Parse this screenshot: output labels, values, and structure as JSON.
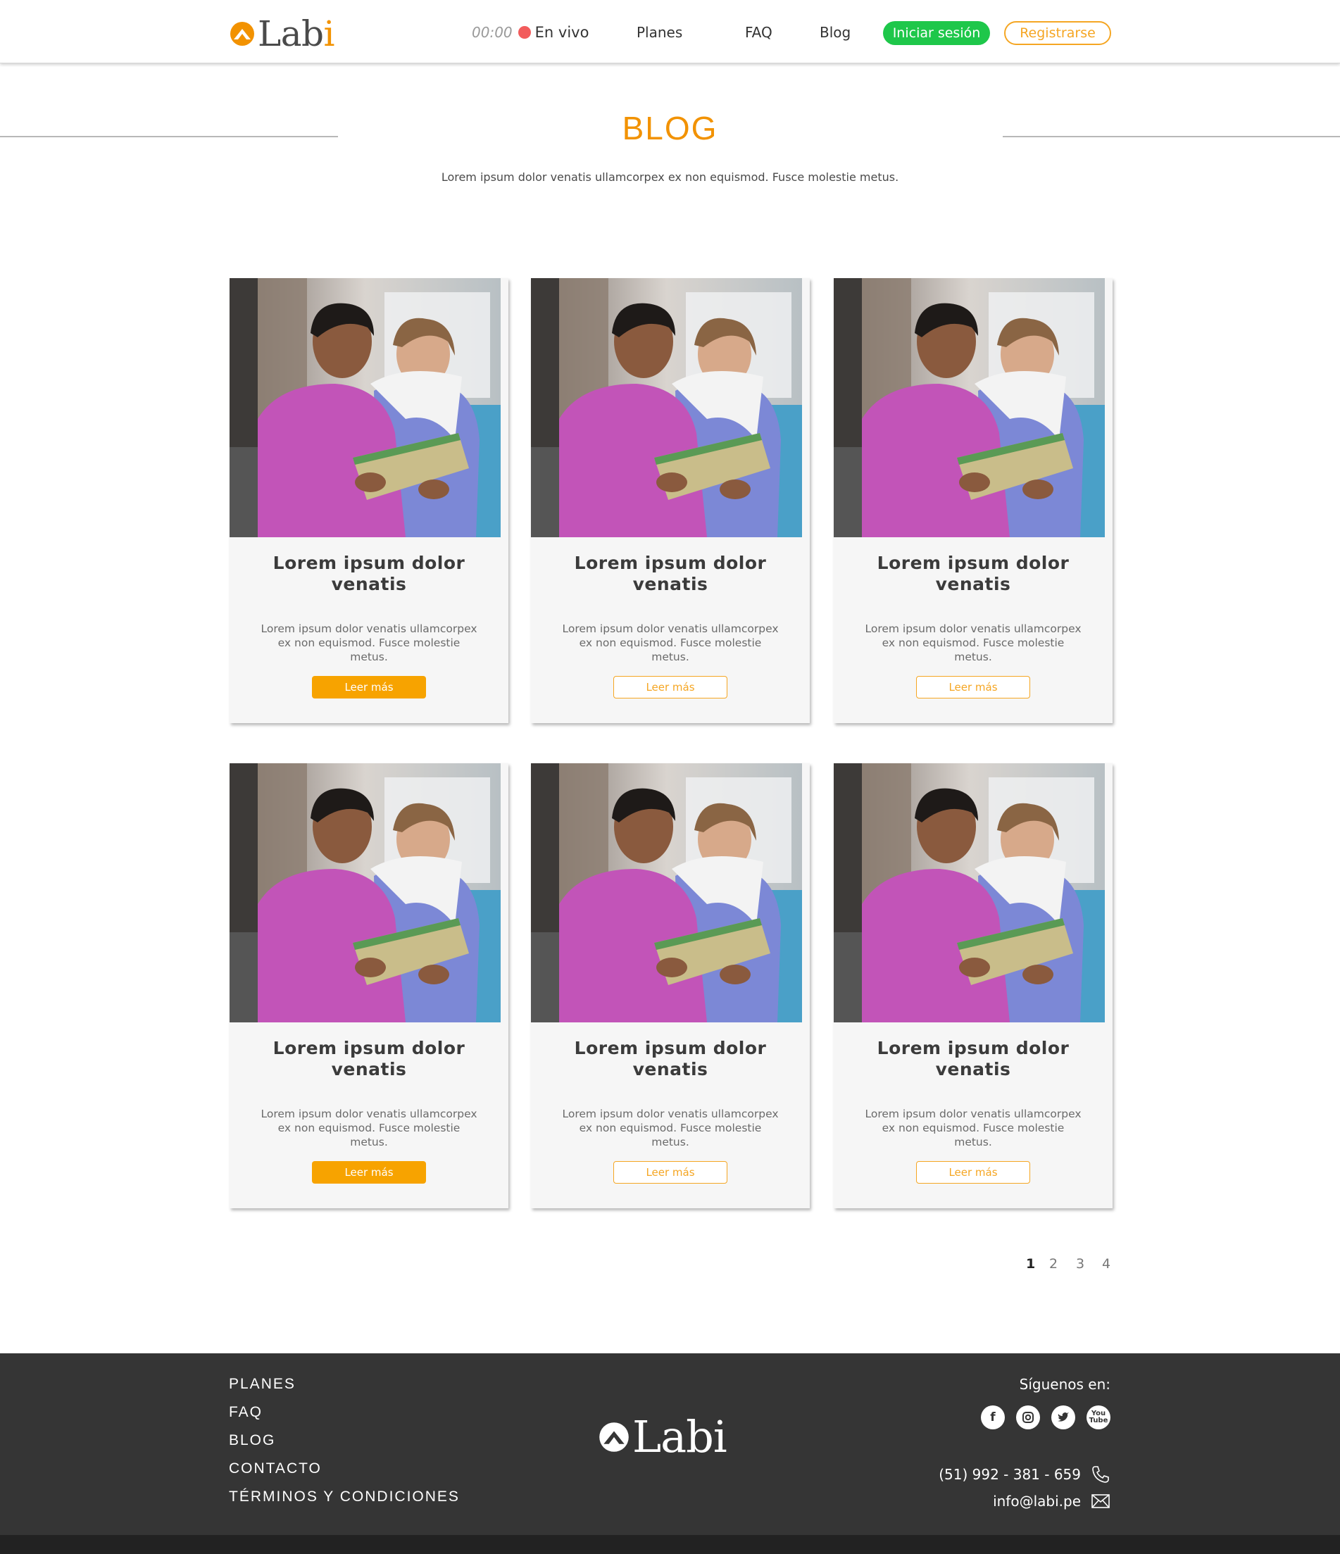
{
  "header": {
    "logo_text": "Lab",
    "logo_i": "i",
    "live_time": "00:00",
    "live_label": "En vivo",
    "nav": [
      "Planes",
      "FAQ",
      "Blog"
    ],
    "login_label": "Iniciar sesión",
    "register_label": "Registrarse"
  },
  "hero": {
    "title": "BLOG",
    "subtitle": "Lorem ipsum dolor venatis ullamcorpex ex non equismod. Fusce molestie metus."
  },
  "cards": [
    {
      "title": "Lorem ipsum dolor venatis",
      "text": "Lorem ipsum dolor venatis ullamcorpex ex non equismod. Fusce molestie metus.",
      "button": "Leer más",
      "style": "filled"
    },
    {
      "title": "Lorem ipsum dolor venatis",
      "text": "Lorem ipsum dolor venatis ullamcorpex ex non equismod. Fusce molestie metus.",
      "button": "Leer más",
      "style": "outline"
    },
    {
      "title": "Lorem ipsum dolor venatis",
      "text": "Lorem ipsum dolor venatis ullamcorpex ex non equismod. Fusce molestie metus.",
      "button": "Leer más",
      "style": "outline"
    },
    {
      "title": "Lorem ipsum dolor venatis",
      "text": "Lorem ipsum dolor venatis ullamcorpex ex non equismod. Fusce molestie metus.",
      "button": "Leer más",
      "style": "filled"
    },
    {
      "title": "Lorem ipsum dolor venatis",
      "text": "Lorem ipsum dolor venatis ullamcorpex ex non equismod. Fusce molestie metus.",
      "button": "Leer más",
      "style": "outline"
    },
    {
      "title": "Lorem ipsum dolor venatis",
      "text": "Lorem ipsum dolor venatis ullamcorpex ex non equismod. Fusce molestie metus.",
      "button": "Leer más",
      "style": "outline"
    }
  ],
  "pagination": {
    "pages": [
      "1",
      "2",
      "3",
      "4"
    ],
    "current": "1"
  },
  "footer": {
    "links": [
      "PLANES",
      "FAQ",
      "BLOG",
      "CONTACTO",
      "TÉRMINOS Y CONDICIONES"
    ],
    "logo_text": "Labi",
    "follow_label": "Síguenos en:",
    "socials": [
      "facebook-icon",
      "instagram-icon",
      "twitter-icon",
      "youtube-icon"
    ],
    "phone": "(51) 992 - 381 - 659",
    "email": "info@labi.pe"
  },
  "colors": {
    "accent_orange": "#f29200",
    "button_orange": "#f7a300",
    "login_green": "#1ec74a",
    "live_red": "#f25c5c",
    "footer_bg": "#353535"
  }
}
